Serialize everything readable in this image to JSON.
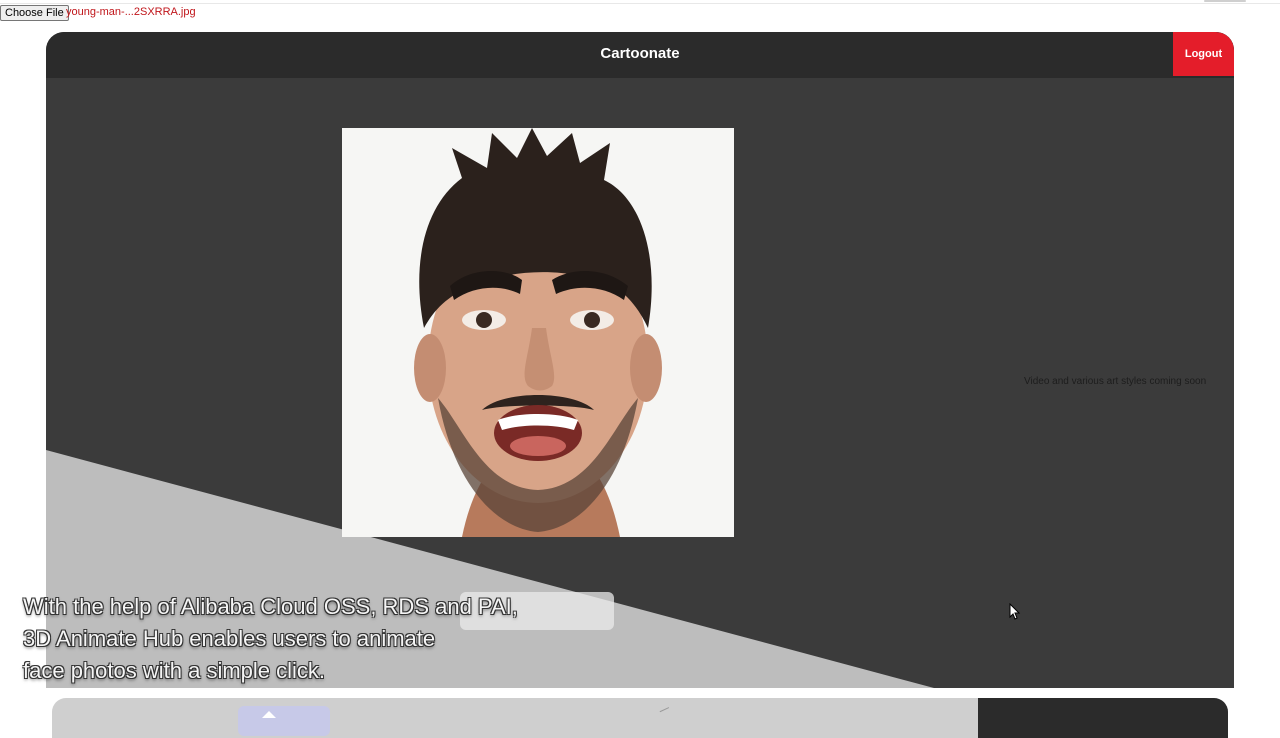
{
  "file_input": {
    "button_label": "Choose File",
    "file_name": "young-man-...2SXRRA.jpg"
  },
  "app": {
    "title": "Cartoonate",
    "logout_label": "Logout",
    "coming_soon": "Video and various art styles coming soon"
  },
  "caption": {
    "lines": [
      "With the help of Alibaba Cloud OSS, RDS and PAI,",
      "3D Animate Hub enables users to animate",
      "face photos with a simple click."
    ]
  },
  "bottom_nav": {
    "icons": [
      "home-icon",
      "share-icon",
      "download-icon"
    ]
  },
  "colors": {
    "header_bg": "#2b2b2b",
    "content_bg": "#3b3b3b",
    "logout_red": "#e41d2a",
    "file_name_red": "#c0161b",
    "diagonal_grey": "#bdbdbd"
  }
}
